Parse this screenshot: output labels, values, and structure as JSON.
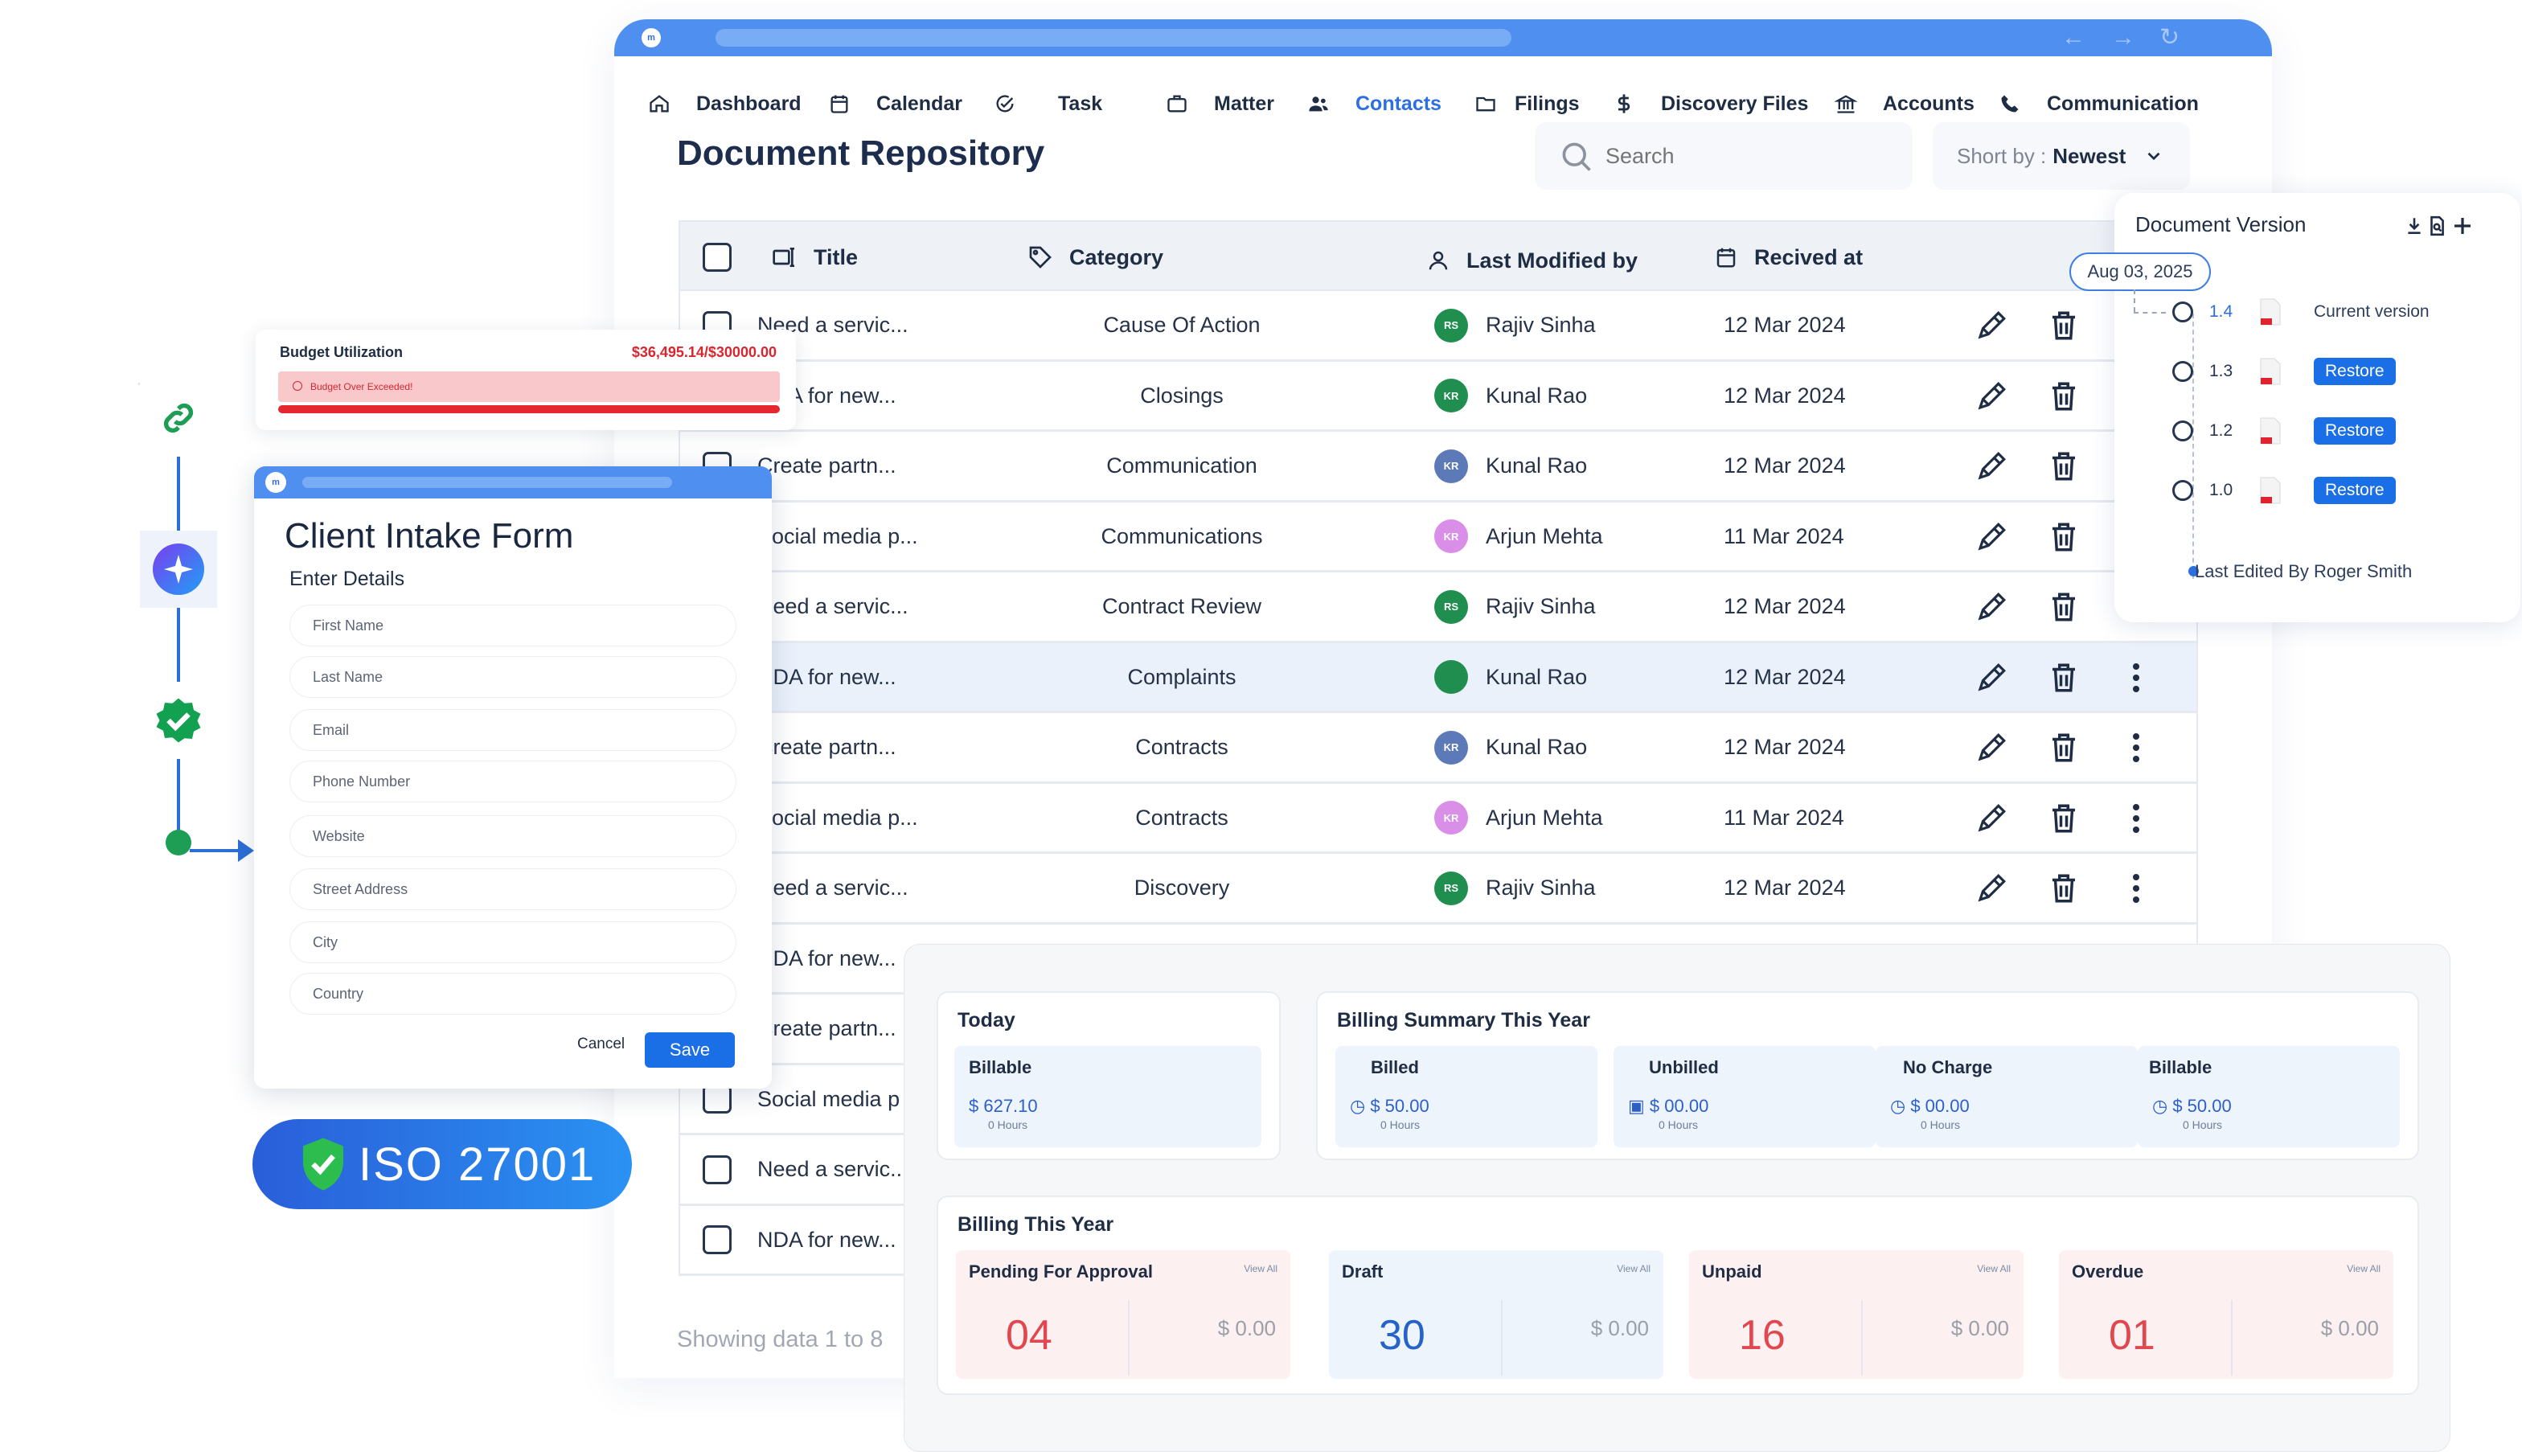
{
  "nav": {
    "items": [
      {
        "label": "Dashboard",
        "icon": "home-icon"
      },
      {
        "label": "Calendar",
        "icon": "calendar-icon"
      },
      {
        "label": "Task",
        "icon": "task-icon"
      },
      {
        "label": "Matter",
        "icon": "briefcase-icon"
      },
      {
        "label": "Contacts",
        "icon": "people-icon",
        "active": true
      },
      {
        "label": "Filings",
        "icon": "folder-icon"
      },
      {
        "label": "Discovery Files",
        "icon": "dollar-icon"
      },
      {
        "label": "Accounts",
        "icon": "bank-icon"
      },
      {
        "label": "Communication",
        "icon": "phone-icon"
      }
    ]
  },
  "page": {
    "title": "Document Repository",
    "search_placeholder": "Search",
    "sort_label": "Short by :",
    "sort_value": "Newest",
    "showing": "Showing data 1 to 8"
  },
  "table": {
    "columns": [
      "Title",
      "Category",
      "Last Modified by",
      "Recived at"
    ],
    "rows": [
      {
        "title": "Need a servic...",
        "category": "Cause Of Action",
        "initials": "RS",
        "modified_by": "Rajiv Sinha",
        "received": "12 Mar 2024",
        "avatar_color": "#1f8e4e"
      },
      {
        "title": "NDA for new...",
        "category": "Closings",
        "initials": "KR",
        "modified_by": "Kunal Rao",
        "received": "12 Mar 2024",
        "avatar_color": "#1f8e4e"
      },
      {
        "title": "Create partn...",
        "category": "Communication",
        "initials": "KR",
        "modified_by": "Kunal Rao",
        "received": "12 Mar 2024",
        "avatar_color": "#5c7ab8"
      },
      {
        "title": "Social media p...",
        "category": "Communications",
        "initials": "KR",
        "modified_by": "Arjun Mehta",
        "received": "11 Mar 2024",
        "avatar_color": "#d98ee8"
      },
      {
        "title": "Need a servic...",
        "category": "Contract Review",
        "initials": "RS",
        "modified_by": "Rajiv Sinha",
        "received": "12 Mar 2024",
        "avatar_color": "#1f8e4e"
      },
      {
        "title": "NDA for new...",
        "category": "Complaints",
        "initials": "",
        "modified_by": "Kunal Rao",
        "received": "12 Mar 2024",
        "avatar_color": "#1f8e4e",
        "highlight": true
      },
      {
        "title": "Create partn...",
        "category": "Contracts",
        "initials": "KR",
        "modified_by": "Kunal Rao",
        "received": "12 Mar 2024",
        "avatar_color": "#5c7ab8"
      },
      {
        "title": "Social media p...",
        "category": "Contracts",
        "initials": "KR",
        "modified_by": "Arjun Mehta",
        "received": "11 Mar 2024",
        "avatar_color": "#d98ee8"
      },
      {
        "title": "Need a servic...",
        "category": "Discovery",
        "initials": "RS",
        "modified_by": "Rajiv Sinha",
        "received": "12 Mar 2024",
        "avatar_color": "#1f8e4e"
      },
      {
        "title": "NDA for new...",
        "category": "",
        "initials": "",
        "modified_by": "",
        "received": "",
        "avatar_color": ""
      },
      {
        "title": "Create partn...",
        "category": "",
        "initials": "",
        "modified_by": "",
        "received": "",
        "avatar_color": ""
      },
      {
        "title": "Social media p",
        "category": "",
        "initials": "",
        "modified_by": "",
        "received": "",
        "avatar_color": ""
      },
      {
        "title": "Need a servic...",
        "category": "",
        "initials": "",
        "modified_by": "",
        "received": "",
        "avatar_color": ""
      },
      {
        "title": "NDA for new...",
        "category": "",
        "initials": "",
        "modified_by": "",
        "received": "",
        "avatar_color": ""
      }
    ]
  },
  "version_panel": {
    "title": "Document Version",
    "date": "Aug 03, 2025",
    "versions": [
      {
        "num": "1.4",
        "label": "Current version",
        "current": true
      },
      {
        "num": "1.3",
        "label": "Restore"
      },
      {
        "num": "1.2",
        "label": "Restore"
      },
      {
        "num": "1.0",
        "label": "Restore"
      }
    ],
    "last_edited": "Last Edited By Roger Smith"
  },
  "budget": {
    "label": "Budget Utilization",
    "amount": "$36,495.14/$30000.00",
    "alert": "Budget Over Exceeded!",
    "utilization_fraction": 1.0
  },
  "intake_form": {
    "title": "Client Intake Form",
    "subtitle": "Enter Details",
    "fields": [
      "First Name",
      "Last Name",
      "Email",
      "Phone Number",
      "Website",
      "Street Address",
      "City",
      "Country"
    ],
    "cancel": "Cancel",
    "save": "Save"
  },
  "iso": {
    "label": "ISO 27001"
  },
  "billing": {
    "today": {
      "title": "Today",
      "label": "Billable",
      "value": "$ 627.10",
      "hours": "0 Hours"
    },
    "summary": {
      "title": "Billing Summary This Year",
      "items": [
        {
          "label": "Billed",
          "value": "$ 50.00",
          "hours": "0 Hours"
        },
        {
          "label": "Unbilled",
          "value": "$ 00.00",
          "hours": "0 Hours"
        },
        {
          "label": "No Charge",
          "value": "$ 00.00",
          "hours": "0 Hours"
        },
        {
          "label": "Billable",
          "value": "$ 50.00",
          "hours": "0 Hours"
        }
      ]
    },
    "year": {
      "title": "Billing This Year",
      "view_all": "View All",
      "items": [
        {
          "label": "Pending For Approval",
          "count": "04",
          "amount": "$ 0.00",
          "color": "#e0474f",
          "bg": "#fdf0f0"
        },
        {
          "label": "Draft",
          "count": "30",
          "amount": "$ 0.00",
          "color": "#2563c9",
          "bg": "#eef4fb"
        },
        {
          "label": "Unpaid",
          "count": "16",
          "amount": "$ 0.00",
          "color": "#e0474f",
          "bg": "#fdf0f0"
        },
        {
          "label": "Overdue",
          "count": "01",
          "amount": "$ 0.00",
          "color": "#e0474f",
          "bg": "#fdf0f0"
        }
      ]
    }
  },
  "colors": {
    "accent": "#2c6fe0",
    "window_bar": "#4e8ff0",
    "alert": "#d8262f"
  }
}
